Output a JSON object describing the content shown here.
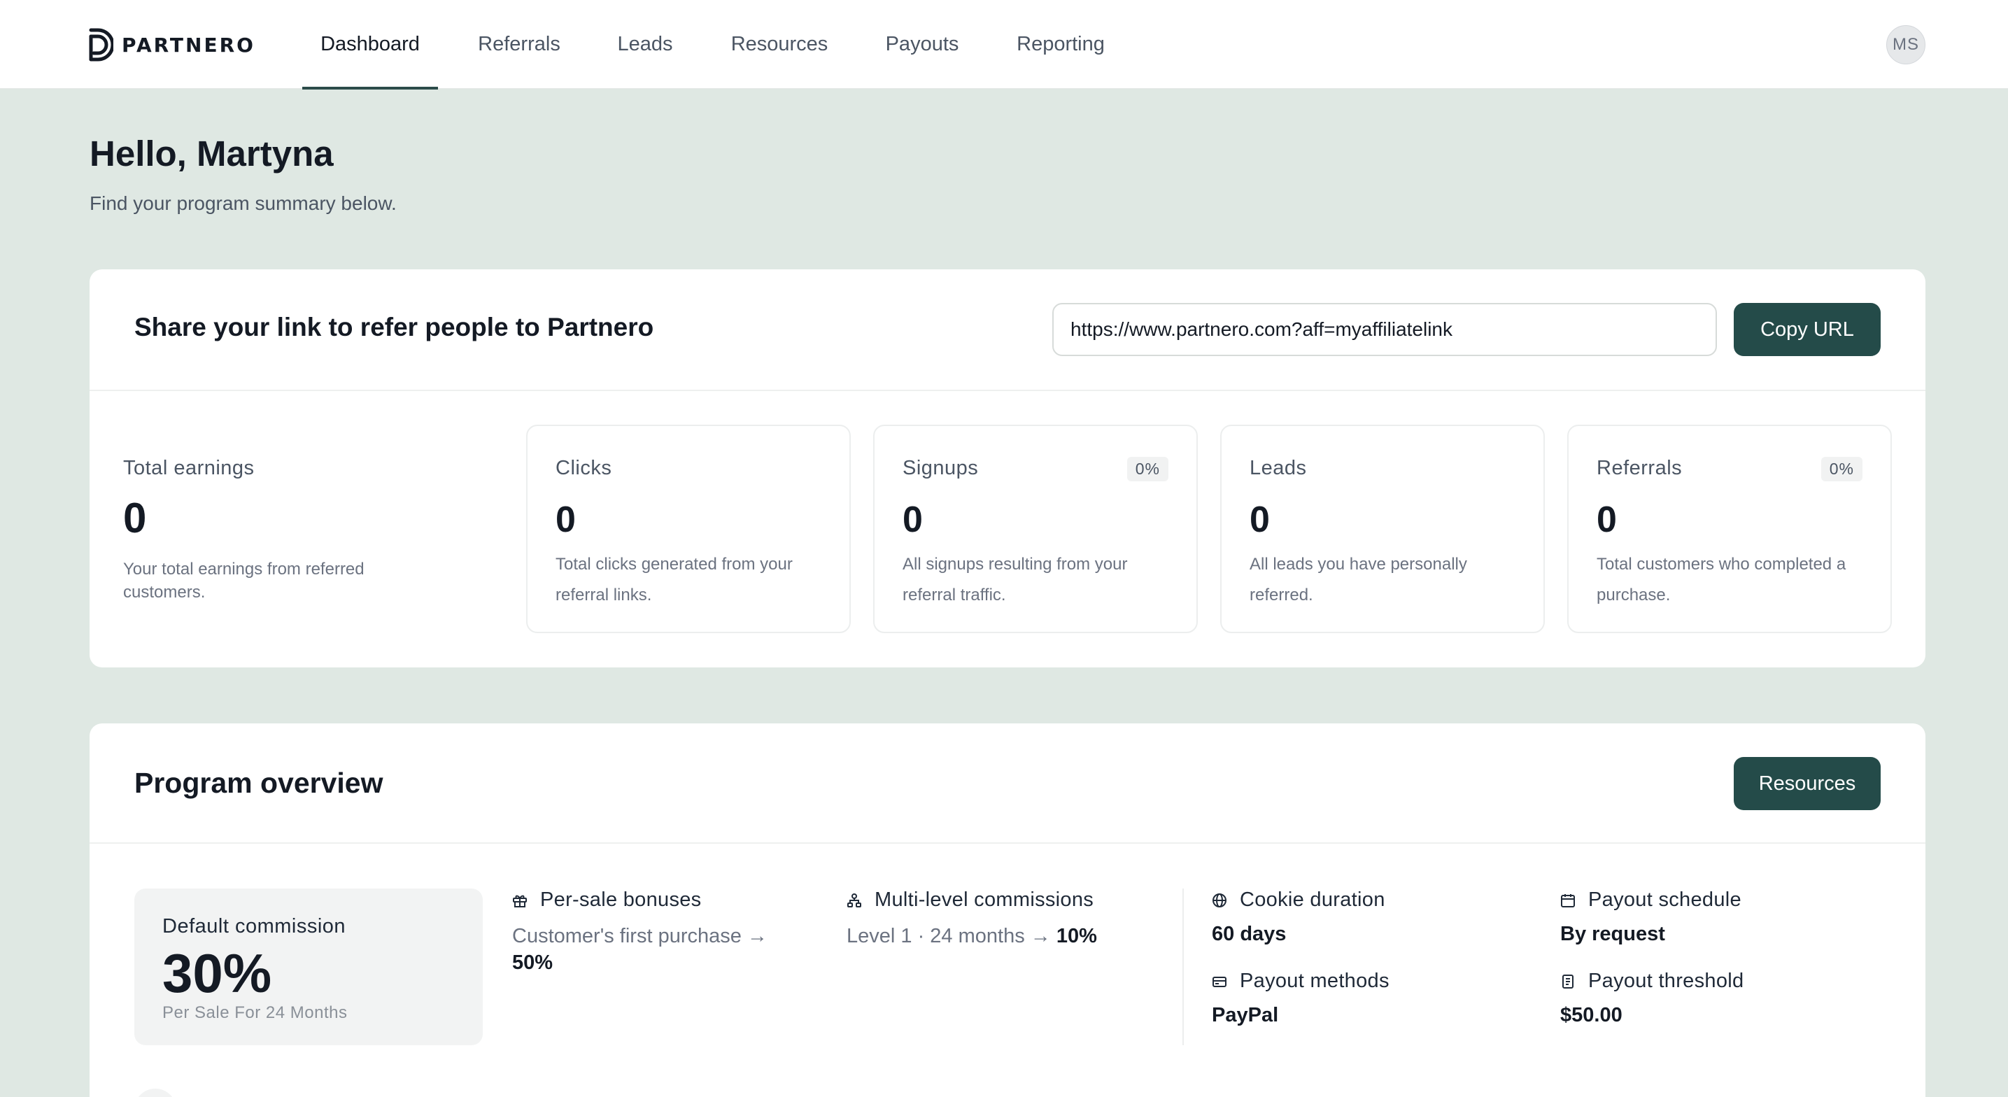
{
  "brand": {
    "name": "PARTNERO"
  },
  "nav": {
    "tabs": [
      {
        "label": "Dashboard",
        "active": true
      },
      {
        "label": "Referrals",
        "active": false
      },
      {
        "label": "Leads",
        "active": false
      },
      {
        "label": "Resources",
        "active": false
      },
      {
        "label": "Payouts",
        "active": false
      },
      {
        "label": "Reporting",
        "active": false
      }
    ],
    "avatar_initials": "MS"
  },
  "greeting": {
    "title": "Hello, Martyna",
    "subtitle": "Find your program summary below."
  },
  "share": {
    "title": "Share your link to refer people to Partnero",
    "url_value": "https://www.partnero.com?aff=myaffiliatelink",
    "copy_label": "Copy URL"
  },
  "stats": {
    "earnings": {
      "label": "Total earnings",
      "value": "0",
      "desc": "Your total earnings from referred customers."
    },
    "clicks": {
      "label": "Clicks",
      "value": "0",
      "desc": "Total clicks generated from your referral links."
    },
    "signups": {
      "label": "Signups",
      "value": "0",
      "badge": "0%",
      "desc": "All signups resulting from your referral traffic."
    },
    "leads": {
      "label": "Leads",
      "value": "0",
      "desc": "All leads you have personally referred."
    },
    "referrals": {
      "label": "Referrals",
      "value": "0",
      "badge": "0%",
      "desc": "Total customers who completed a purchase."
    }
  },
  "program": {
    "title": "Program overview",
    "resources_label": "Resources",
    "commission": {
      "label": "Default commission",
      "value": "30%",
      "sub": "Per Sale For 24 Months"
    },
    "bonuses": {
      "label": "Per-sale bonuses",
      "text": "Customer's first purchase →",
      "value": "50%",
      "icon": "gift-icon"
    },
    "multilevel": {
      "label": "Multi-level commissions",
      "text": "Level 1 · 24 months →",
      "value": "10%",
      "icon": "hierarchy-icon"
    },
    "cookie": {
      "label": "Cookie duration",
      "value": "60 days",
      "icon": "globe-icon"
    },
    "schedule": {
      "label": "Payout schedule",
      "value": "By request",
      "icon": "calendar-icon"
    },
    "methods": {
      "label": "Payout methods",
      "value": "PayPal",
      "icon": "credit-card-icon"
    },
    "threshold": {
      "label": "Payout threshold",
      "value": "$50.00",
      "icon": "receipt-icon"
    }
  },
  "colors": {
    "background": "#dfe8e3",
    "accent": "#244b49",
    "text": "#141a24",
    "muted": "#6b7280"
  }
}
